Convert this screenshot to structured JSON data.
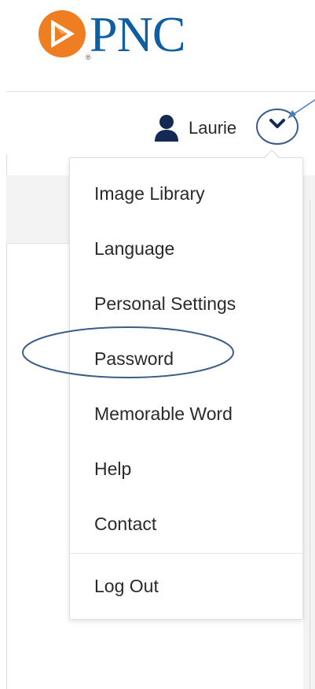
{
  "brand": {
    "logo_text": "PNC",
    "registered_mark": "®",
    "logo_color": "#0e5ea1",
    "mark_color": "#ef7d22"
  },
  "header": {
    "user_name": "Laurie",
    "user_icon": "user-icon",
    "dropdown_icon": "chevron-down-icon"
  },
  "dropdown": {
    "items": [
      {
        "label": "Image Library"
      },
      {
        "label": "Language"
      },
      {
        "label": "Personal Settings"
      },
      {
        "label": "Password"
      },
      {
        "label": "Memorable Word"
      },
      {
        "label": "Help"
      },
      {
        "label": "Contact"
      }
    ],
    "logout_label": "Log Out"
  },
  "annotations": {
    "highlight_color": "#3d5c86",
    "arrow_color": "#4a7cc0",
    "highlighted_item": "Password"
  }
}
